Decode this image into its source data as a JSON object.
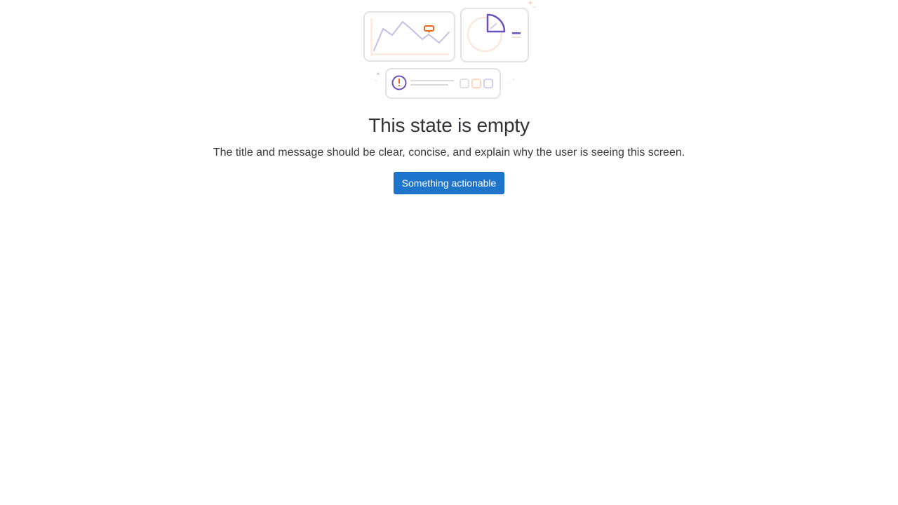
{
  "empty_state": {
    "illustration_icon": "empty-dashboard-illustration",
    "title": "This state is empty",
    "message": "The title and message should be clear, concise, and explain why the user is seeing this screen.",
    "action_label": "Something actionable"
  },
  "colors": {
    "background": "#ffffff",
    "text": "#333238",
    "button": "#1f75cb",
    "button_border": "#1068bf",
    "button_text": "#ffffff",
    "illustration_purple": "#6b4fbb",
    "illustration_orange": "#e9681d",
    "illustration_gray": "#dcdcde"
  }
}
